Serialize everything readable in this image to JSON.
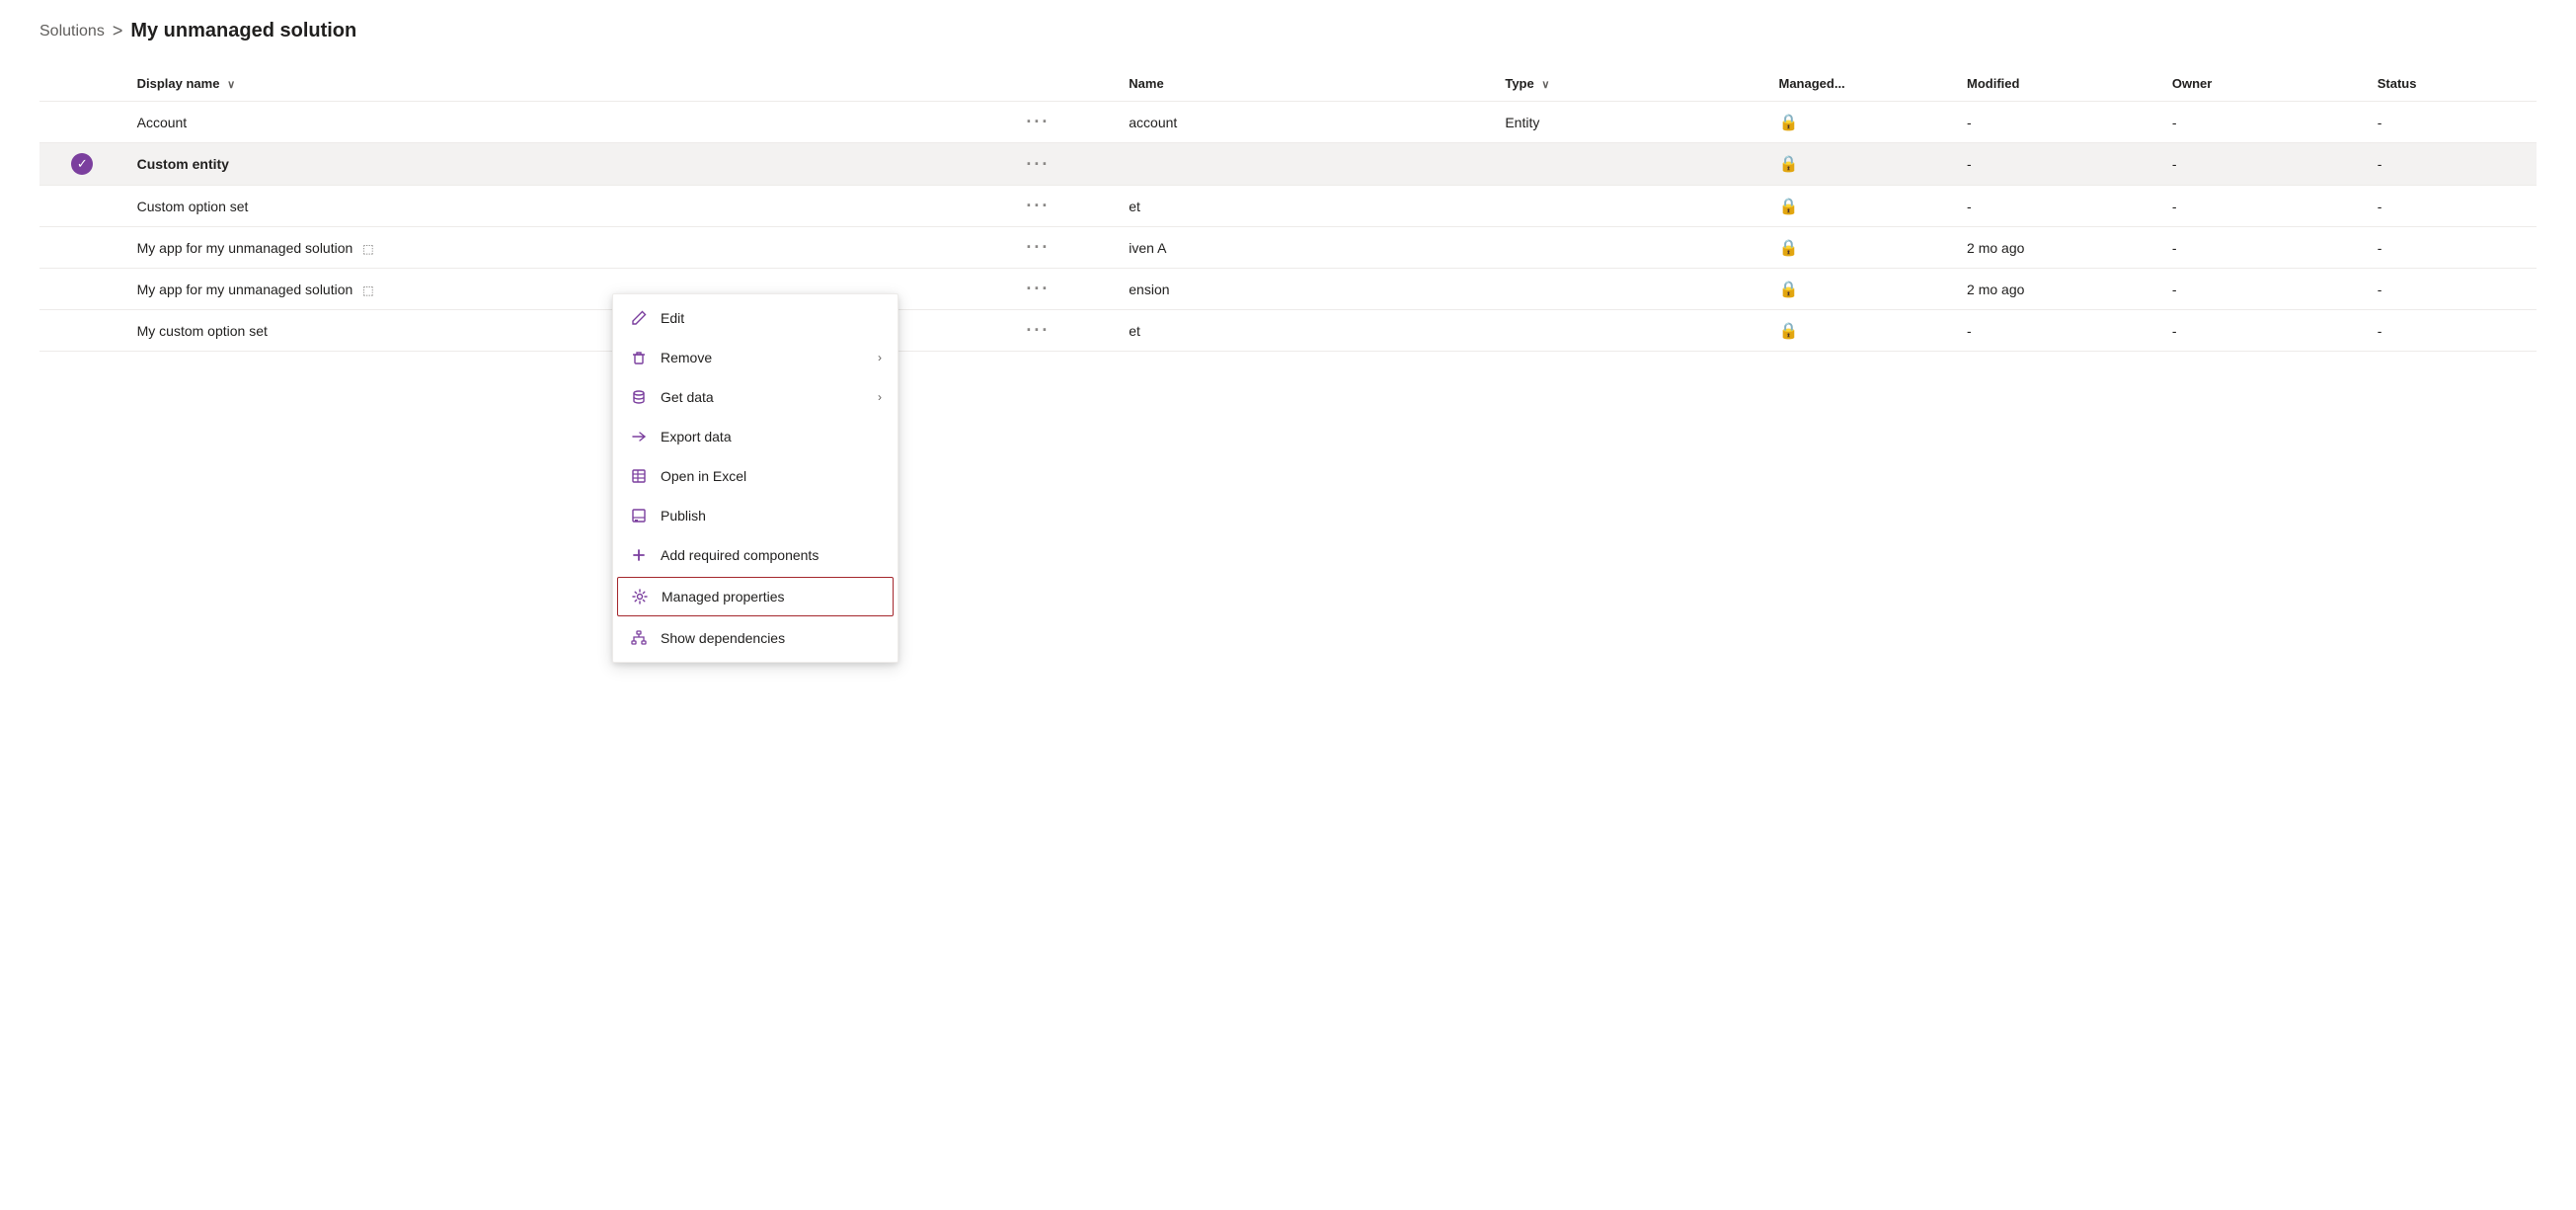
{
  "breadcrumb": {
    "parent": "Solutions",
    "separator": ">",
    "current": "My unmanaged solution"
  },
  "table": {
    "columns": [
      {
        "id": "selector",
        "label": ""
      },
      {
        "id": "display_name",
        "label": "Display name",
        "sortable": true
      },
      {
        "id": "options",
        "label": ""
      },
      {
        "id": "name",
        "label": "Name"
      },
      {
        "id": "type",
        "label": "Type",
        "sortable": true
      },
      {
        "id": "managed",
        "label": "Managed..."
      },
      {
        "id": "modified",
        "label": "Modified"
      },
      {
        "id": "owner",
        "label": "Owner"
      },
      {
        "id": "status",
        "label": "Status"
      }
    ],
    "rows": [
      {
        "id": "row1",
        "selected": false,
        "display_name": "Account",
        "has_external_link": false,
        "name": "account",
        "type": "Entity",
        "managed_lock": true,
        "modified": "-",
        "owner": "-",
        "status": "-"
      },
      {
        "id": "row2",
        "selected": true,
        "display_name": "Custom entity",
        "has_external_link": false,
        "name": "",
        "type": "",
        "managed_lock": true,
        "modified": "-",
        "owner": "-",
        "status": "-"
      },
      {
        "id": "row3",
        "selected": false,
        "display_name": "Custom option set",
        "has_external_link": false,
        "name": "et",
        "type": "",
        "managed_lock": true,
        "modified": "-",
        "owner": "-",
        "status": "-"
      },
      {
        "id": "row4",
        "selected": false,
        "display_name": "My app for my unmanaged solution",
        "has_external_link": true,
        "name": "iven A",
        "type": "",
        "managed_lock": true,
        "modified": "2 mo ago",
        "owner": "-",
        "status": "-"
      },
      {
        "id": "row5",
        "selected": false,
        "display_name": "My app for my unmanaged solution",
        "has_external_link": true,
        "name": "ension",
        "type": "",
        "managed_lock": true,
        "modified": "2 mo ago",
        "owner": "-",
        "status": "-"
      },
      {
        "id": "row6",
        "selected": false,
        "display_name": "My custom option set",
        "has_external_link": false,
        "name": "et",
        "type": "",
        "managed_lock": true,
        "modified": "-",
        "owner": "-",
        "status": "-"
      }
    ]
  },
  "context_menu": {
    "items": [
      {
        "id": "edit",
        "label": "Edit",
        "icon": "pencil",
        "has_submenu": false,
        "highlighted": false
      },
      {
        "id": "remove",
        "label": "Remove",
        "icon": "trash",
        "has_submenu": true,
        "highlighted": false
      },
      {
        "id": "get_data",
        "label": "Get data",
        "icon": "database",
        "has_submenu": true,
        "highlighted": false
      },
      {
        "id": "export_data",
        "label": "Export data",
        "icon": "export",
        "has_submenu": false,
        "highlighted": false
      },
      {
        "id": "open_excel",
        "label": "Open in Excel",
        "icon": "excel",
        "has_submenu": false,
        "highlighted": false
      },
      {
        "id": "publish",
        "label": "Publish",
        "icon": "publish",
        "has_submenu": false,
        "highlighted": false
      },
      {
        "id": "add_components",
        "label": "Add required components",
        "icon": "plus",
        "has_submenu": false,
        "highlighted": false
      },
      {
        "id": "managed_properties",
        "label": "Managed properties",
        "icon": "gear",
        "has_submenu": false,
        "highlighted": true
      },
      {
        "id": "show_dependencies",
        "label": "Show dependencies",
        "icon": "hierarchy",
        "has_submenu": false,
        "highlighted": false
      }
    ]
  },
  "icons": {
    "pencil": "✏",
    "trash": "🗑",
    "database": "🗄",
    "export": "→",
    "excel": "⊞",
    "publish": "⊟",
    "plus": "+",
    "gear": "⚙",
    "hierarchy": "⊕",
    "lock": "🔒",
    "ellipsis": "···",
    "check": "✓",
    "chevron_right": "›",
    "sort_down": "∨",
    "external_link": "⬚"
  }
}
